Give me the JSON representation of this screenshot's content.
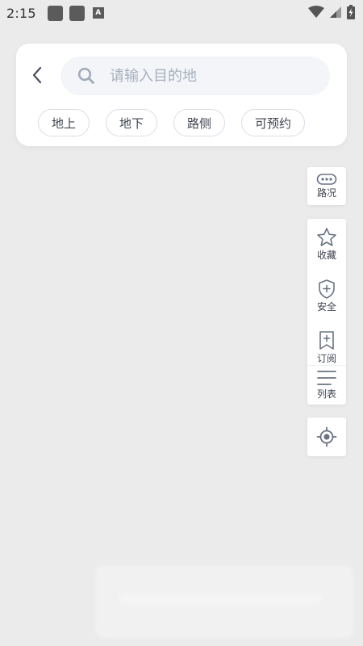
{
  "status_bar": {
    "time": "2:15",
    "a_icon_text": "A"
  },
  "search": {
    "placeholder": "请输入目的地"
  },
  "filters": [
    {
      "label": "地上"
    },
    {
      "label": "地下"
    },
    {
      "label": "路侧"
    },
    {
      "label": "可预约"
    }
  ],
  "tools": {
    "traffic": "路况",
    "favorite": "收藏",
    "safety": "安全",
    "subscribe": "订阅",
    "list": "列表"
  },
  "colors": {
    "background": "#ebebeb",
    "card": "#ffffff",
    "icon_gray": "#6b7382",
    "placeholder": "#a8afbd"
  }
}
